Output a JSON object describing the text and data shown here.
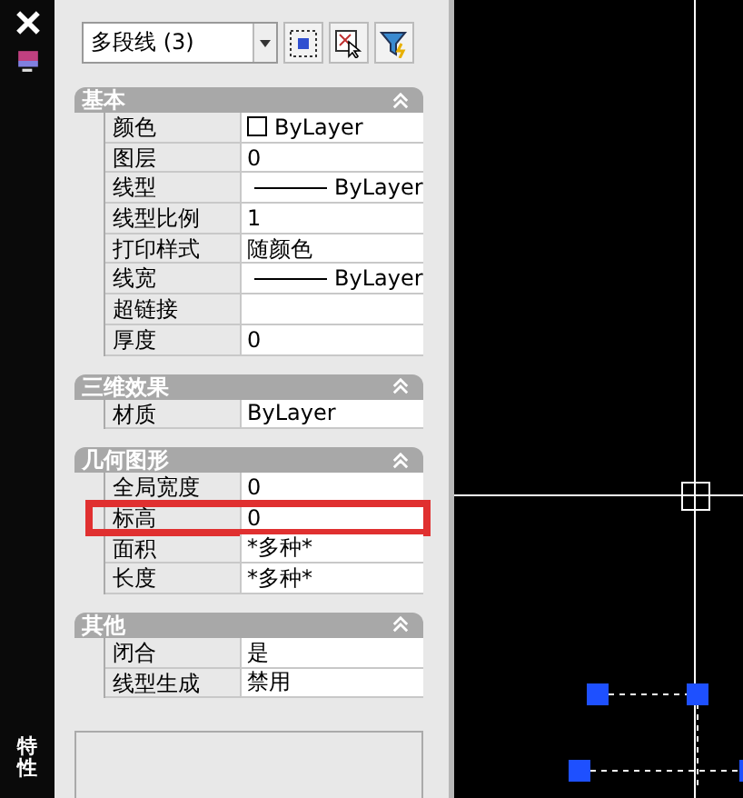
{
  "palette": {
    "title": "特性",
    "object_type": "多段线 (3)"
  },
  "sections": [
    {
      "title": "基本",
      "expanded": true,
      "rows": [
        {
          "label": "颜色",
          "value": "ByLayer",
          "kind": "swatch",
          "highlighted": false
        },
        {
          "label": "图层",
          "value": "0",
          "kind": "text",
          "highlighted": false
        },
        {
          "label": "线型",
          "value": "ByLayer",
          "kind": "line",
          "highlighted": false
        },
        {
          "label": "线型比例",
          "value": "1",
          "kind": "text",
          "highlighted": false
        },
        {
          "label": "打印样式",
          "value": "随颜色",
          "kind": "text",
          "highlighted": false
        },
        {
          "label": "线宽",
          "value": "ByLayer",
          "kind": "line",
          "highlighted": false
        },
        {
          "label": "超链接",
          "kind": "text",
          "highlighted": false
        },
        {
          "label": "厚度",
          "value": "0",
          "kind": "text",
          "highlighted": false
        }
      ]
    },
    {
      "title": "三维效果",
      "expanded": true,
      "rows": [
        {
          "label": "材质",
          "value": "ByLayer",
          "kind": "text",
          "highlighted": false
        }
      ]
    },
    {
      "title": "几何图形",
      "expanded": true,
      "rows": [
        {
          "label": "全局宽度",
          "value": "0",
          "kind": "text",
          "highlighted": false
        },
        {
          "label": "标高",
          "value": "0",
          "kind": "text",
          "highlighted": true
        },
        {
          "label": "面积",
          "value": "*多种*",
          "kind": "text",
          "highlighted": false
        },
        {
          "label": "长度",
          "value": "*多种*",
          "kind": "text",
          "highlighted": false
        }
      ]
    },
    {
      "title": "其他",
      "expanded": true,
      "rows": [
        {
          "label": "闭合",
          "value": "是",
          "kind": "text",
          "highlighted": false
        },
        {
          "label": "线型生成",
          "value": "禁用",
          "kind": "text",
          "highlighted": false
        }
      ]
    }
  ]
}
